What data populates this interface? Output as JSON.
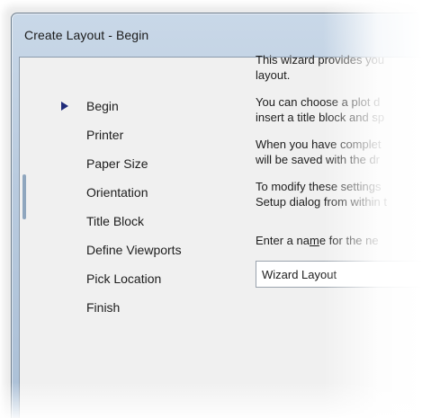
{
  "window": {
    "title": "Create Layout - Begin"
  },
  "nav": {
    "items": [
      {
        "label": "Begin",
        "current": true
      },
      {
        "label": "Printer",
        "current": false
      },
      {
        "label": "Paper Size",
        "current": false
      },
      {
        "label": "Orientation",
        "current": false
      },
      {
        "label": "Title Block",
        "current": false
      },
      {
        "label": "Define Viewports",
        "current": false
      },
      {
        "label": "Pick Location",
        "current": false
      },
      {
        "label": "Finish",
        "current": false
      }
    ]
  },
  "content": {
    "para1": "This wizard provides you\nlayout.",
    "para2": "You can choose a plot d\ninsert a title block and sp",
    "para3": "When you have complet\nwill be saved with the dr",
    "para4": "To modify these settings\nSetup dialog from within t",
    "name_label_before": "Enter a na",
    "name_label_mnemonic": "m",
    "name_label_after": "e for the ne",
    "name_value": "Wizard Layout"
  },
  "colors": {
    "arrow": "#1f2b7a",
    "titlebar": "#b9cbdf",
    "client": "#f0f0f0"
  }
}
